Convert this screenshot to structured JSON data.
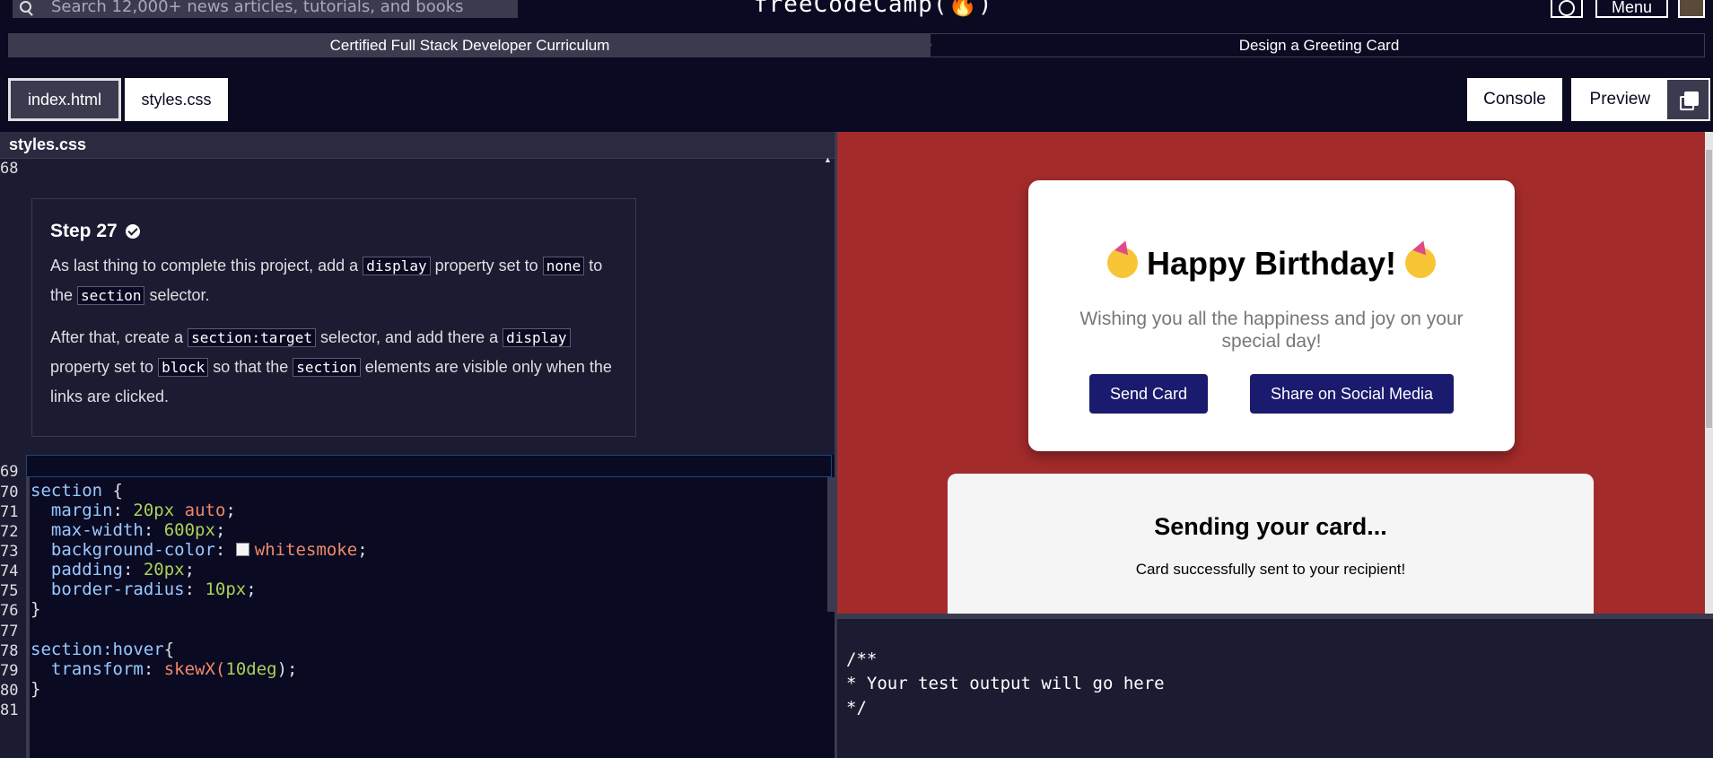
{
  "nav": {
    "search_placeholder": "Search 12,000+ news articles, tutorials, and books",
    "brand": "freeCodeCamp(🔥)",
    "menu_label": "Menu"
  },
  "breadcrumb": {
    "curriculum": "Certified Full Stack Developer Curriculum",
    "project": "Design a Greeting Card"
  },
  "tabs": {
    "index": "index.html",
    "styles": "styles.css",
    "console": "Console",
    "preview": "Preview"
  },
  "editor": {
    "file_label": "styles.css",
    "line_68": "68",
    "step": {
      "title": "Step 27",
      "p1_a": "As last thing to complete this project, add a ",
      "p1_code1": "display",
      "p1_b": " property set to ",
      "p1_code2": "none",
      "p1_c": " to the ",
      "p1_code3": "section",
      "p1_d": " selector.",
      "p2_a": "After that, create a ",
      "p2_code1": "section:target",
      "p2_b": " selector, and add there a ",
      "p2_code2": "display",
      "p2_c": " property set to ",
      "p2_code3": "block",
      "p2_d": " so that the ",
      "p2_code4": "section",
      "p2_e": " elements are visible only when the links are clicked."
    },
    "line_numbers": [
      "69",
      "70",
      "71",
      "72",
      "73",
      "74",
      "75",
      "76",
      "77",
      "78",
      "79",
      "80",
      "81"
    ],
    "code": {
      "l70_sel": "section",
      "l70_rest": " {",
      "l71_prop": "  margin",
      "l71_num": "20px",
      "l71_kw": "auto",
      "l72_prop": "  max-width",
      "l72_num": "600px",
      "l73_prop": "  background-color",
      "l73_kw": "whitesmoke",
      "l74_prop": "  padding",
      "l74_num": "20px",
      "l75_prop": "  border-radius",
      "l75_num": "10px",
      "l76": "}",
      "l78_sel": "section:hover",
      "l78_rest": "{",
      "l79_prop": "  transform",
      "l79_fn": "skewX(",
      "l79_num": "10deg",
      "l79_end": ");",
      "l80": "}"
    }
  },
  "preview": {
    "card_title": "Happy Birthday!",
    "card_message": "Wishing you all the happiness and joy on your special day!",
    "send_button": "Send Card",
    "share_button": "Share on Social Media",
    "section_title": "Sending your card...",
    "section_text": "Card successfully sent to your recipient!"
  },
  "console_output": "/**\n* Your test output will go here\n*/"
}
